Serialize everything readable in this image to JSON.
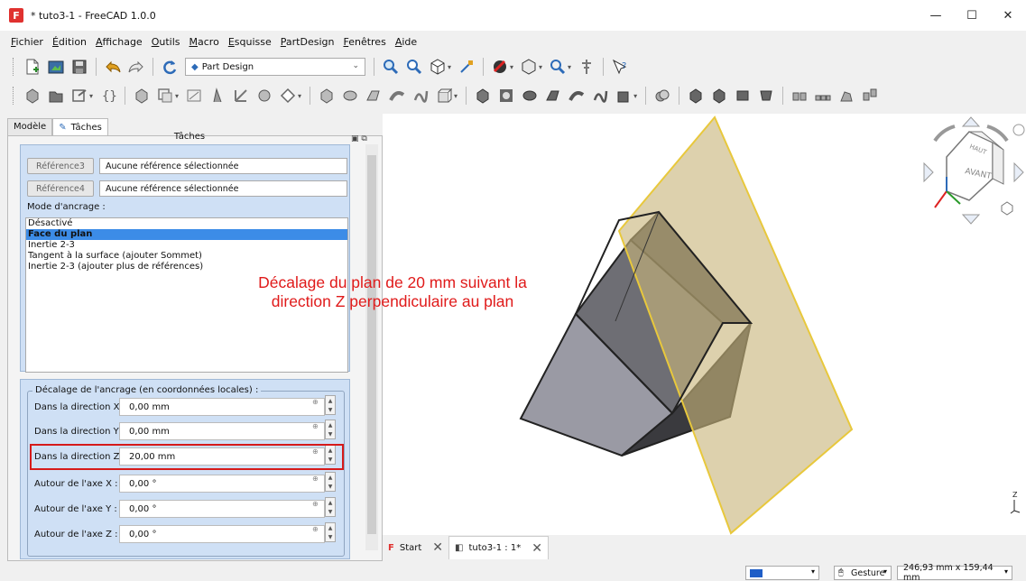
{
  "window": {
    "title": "* tuto3-1 - FreeCAD 1.0.0",
    "minimize": "—",
    "maximize": "☐",
    "close": "✕"
  },
  "menu": [
    "Fichier",
    "Édition",
    "Affichage",
    "Outils",
    "Macro",
    "Esquisse",
    "PartDesign",
    "Fenêtres",
    "Aide"
  ],
  "toolbar": {
    "workbench": "Part Design"
  },
  "panel": {
    "tabs": [
      "Modèle",
      "Tâches"
    ],
    "header": "Tâches",
    "ref3_label": "Référence3",
    "ref3_value": "Aucune référence sélectionnée",
    "ref4_label": "Référence4",
    "ref4_value": "Aucune référence sélectionnée",
    "mode_label": "Mode d'ancrage :",
    "modes": [
      {
        "label": "Désactivé",
        "selected": false
      },
      {
        "label": "Face du plan",
        "selected": true
      },
      {
        "label": "Inertie 2-3",
        "selected": false
      },
      {
        "label": "Tangent à la surface (ajouter Sommet)",
        "selected": false
      },
      {
        "label": "Inertie 2-3 (ajouter plus de références)",
        "selected": false
      }
    ],
    "offset_legend": "Décalage de l'ancrage (en coordonnées locales) :",
    "offsets": [
      {
        "label": "Dans la direction X :",
        "value": "0,00 mm"
      },
      {
        "label": "Dans la direction Y :",
        "value": "0,00 mm"
      },
      {
        "label": "Dans la direction Z :",
        "value": "20,00 mm"
      },
      {
        "label": "Autour de l'axe X :",
        "value": "0,00 °"
      },
      {
        "label": "Autour de l'axe Y :",
        "value": "0,00 °"
      },
      {
        "label": "Autour de l'axe Z :",
        "value": "0,00 °"
      }
    ]
  },
  "annotation": "Décalage du plan de 20 mm suivant la direction Z perpendiculaire au plan",
  "navcube": {
    "top": "HAUT",
    "front": "AVANT"
  },
  "doc_tabs": [
    {
      "label": "Start"
    },
    {
      "label": "tuto3-1 : 1*"
    }
  ],
  "status": {
    "nav_style": "Gesture",
    "dimensions": "246,93 mm x 159,44 mm"
  },
  "axis_label": "Z",
  "colors": {
    "selection": "#3c8ce7",
    "panel_blue": "#cfe0f5",
    "annotation_red": "#e01a1a",
    "plane_fill": "#c8b47a",
    "plane_edge": "#e8c83c"
  }
}
